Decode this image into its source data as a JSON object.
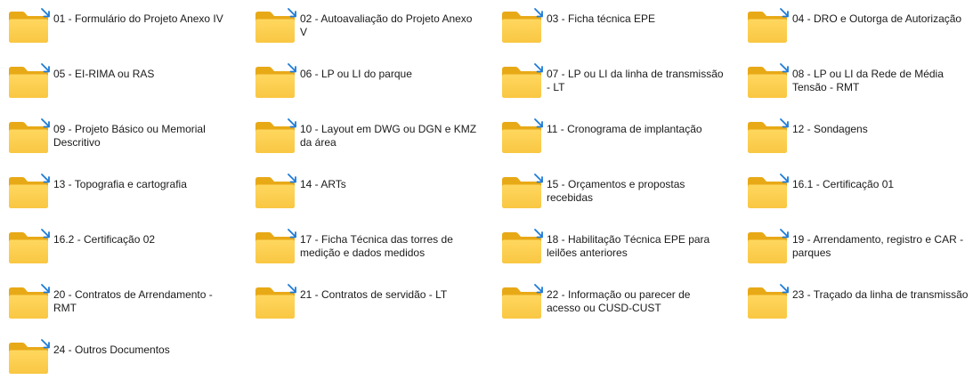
{
  "folder_icon": "folder-icon",
  "badge_icon": "sync-arrow-icon",
  "colors": {
    "folder_back": "#E8A917",
    "folder_front": "#FFD75E",
    "folder_front_bottom": "#F9C743",
    "badge": "#1E7BD6"
  },
  "folders": [
    "01 - Formulário do Projeto Anexo IV",
    "02 - Autoavaliação do Projeto Anexo V",
    "03 - Ficha técnica EPE",
    "04 - DRO e Outorga de Autorização",
    "05 - EI-RIMA ou RAS",
    "06 - LP ou LI do parque",
    "07 - LP ou LI da linha de transmissão - LT",
    "08 - LP ou LI da Rede de Média Tensão - RMT",
    "09 - Projeto Básico ou Memorial Descritivo",
    "10 - Layout em DWG ou DGN e KMZ da área",
    "11 - Cronograma de implantação",
    "12 - Sondagens",
    "13 - Topografia e cartografia",
    "14 - ARTs",
    "15 - Orçamentos e propostas recebidas",
    "16.1 - Certificação 01",
    "16.2 - Certificação 02",
    "17 - Ficha Técnica das torres de medição e dados medidos",
    "18 - Habilitação Técnica EPE para leilões anteriores",
    "19 - Arrendamento, registro e CAR - parques",
    "20 - Contratos de Arrendamento - RMT",
    "21 - Contratos de servidão - LT",
    "22 - Informação ou parecer de acesso ou CUSD-CUST",
    "23 - Traçado da linha de transmissão",
    "24 - Outros Documentos"
  ]
}
